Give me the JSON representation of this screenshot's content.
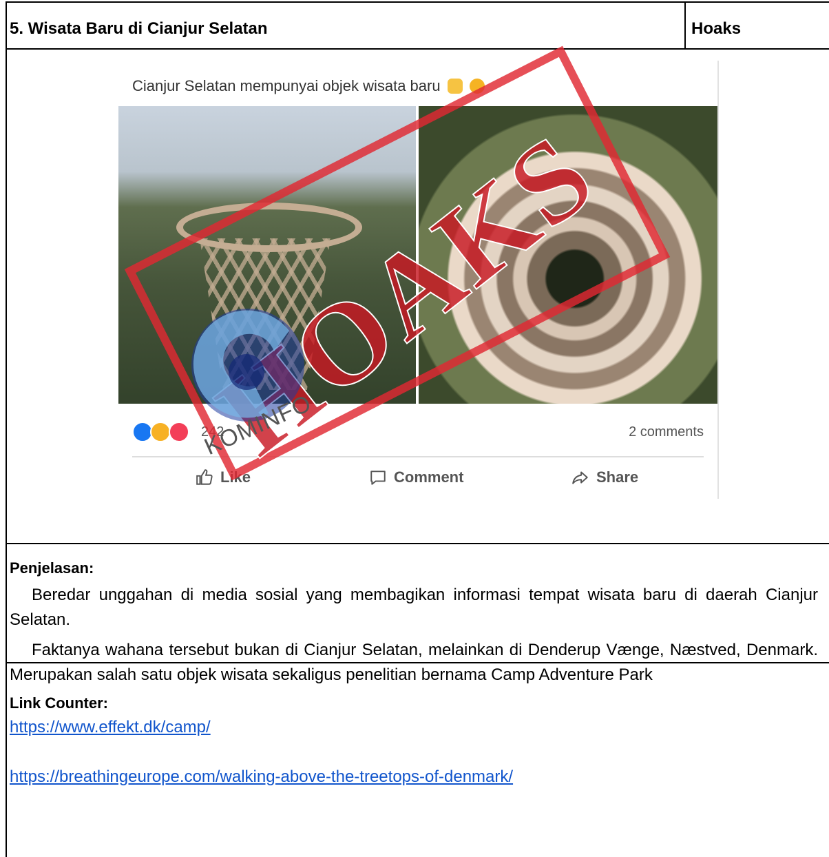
{
  "header": {
    "title": "5. Wisata Baru di Cianjur Selatan",
    "status": "Hoaks"
  },
  "post": {
    "caption": "Cianjur Selatan mempunyai objek wisata baru",
    "reaction_count": "242",
    "comments": "2 comments",
    "actions": [
      "Like",
      "Comment",
      "Share"
    ]
  },
  "watermark": {
    "stamp_text": "HOAKS",
    "logo_text": "KOMINFO"
  },
  "explanation": {
    "label": "Penjelasan:",
    "paragraphs": [
      "Beredar unggahan di media sosial yang membagikan informasi tempat wisata baru di daerah Cianjur Selatan.",
      "Faktanya wahana tersebut bukan di Cianjur Selatan, melainkan di Denderup Vænge, Næstved, Denmark. Merupakan salah satu objek wisata sekaligus penelitian bernama Camp Adventure Park"
    ]
  },
  "links": {
    "label": "Link Counter:",
    "items": [
      "https://www.effekt.dk/camp/",
      "https://breathingeurope.com/walking-above-the-treetops-of-denmark/"
    ]
  },
  "colors": {
    "stamp_red": "#e12832",
    "link_blue": "#1155cc",
    "like_blue": "#1877f2",
    "wow_yellow": "#f7b125",
    "love_red": "#f33e58"
  }
}
